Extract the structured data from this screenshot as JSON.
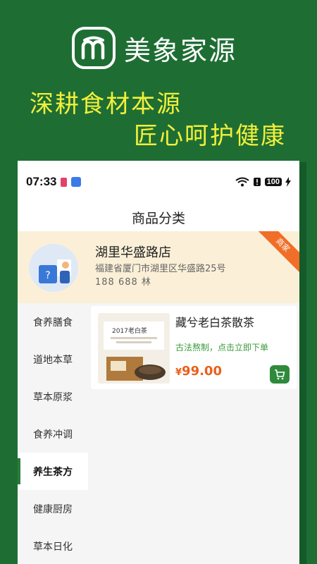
{
  "promo": {
    "brand_name": "美象家源",
    "slogan_line1": "深耕食材本源",
    "slogan_line2": "匠心呵护健康"
  },
  "status_bar": {
    "time": "07:33",
    "battery": "100"
  },
  "header": {
    "title": "商品分类"
  },
  "store": {
    "name": "湖里华盛路店",
    "address": "福建省厦门市湖里区华盛路25号",
    "phone": "188          688  林",
    "ribbon": "商家"
  },
  "sidebar": {
    "items": [
      {
        "label": "食养膳食"
      },
      {
        "label": "道地本草"
      },
      {
        "label": "草本原浆"
      },
      {
        "label": "食养冲调"
      },
      {
        "label": "养生茶方"
      },
      {
        "label": "健康厨房"
      },
      {
        "label": "草本日化"
      }
    ],
    "active_index": 4
  },
  "product": {
    "title": "藏兮老白茶散茶",
    "subtitle": "古法熬制，点击立即下单",
    "currency": "¥",
    "price": "99.00",
    "thumb_text": "2017老白茶"
  },
  "colors": {
    "background_green": "#1e6e34",
    "slogan_yellow": "#f2ef3a",
    "accent_orange": "#e8601b",
    "cart_green": "#2f8a3c"
  }
}
